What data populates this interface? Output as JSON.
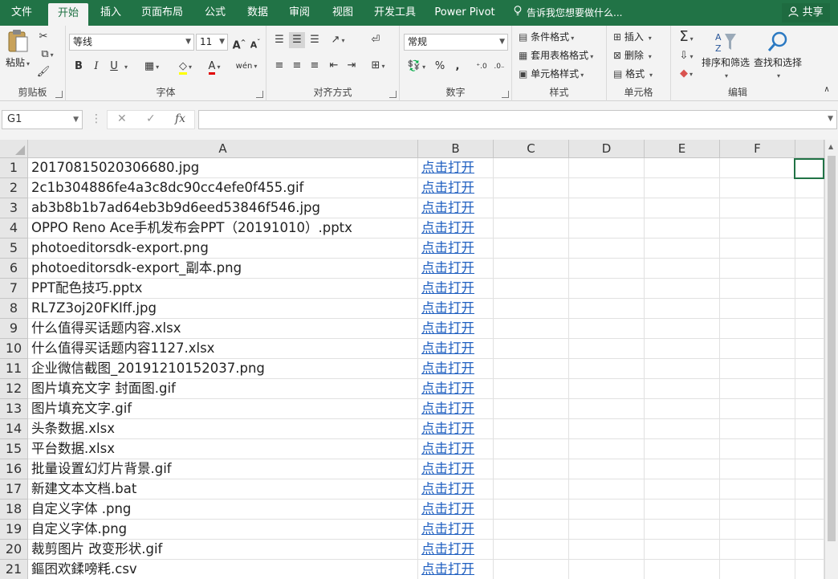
{
  "tabs": [
    {
      "label": "文件",
      "active": false
    },
    {
      "label": "开始",
      "active": true
    },
    {
      "label": "插入",
      "active": false
    },
    {
      "label": "页面布局",
      "active": false
    },
    {
      "label": "公式",
      "active": false
    },
    {
      "label": "数据",
      "active": false
    },
    {
      "label": "审阅",
      "active": false
    },
    {
      "label": "视图",
      "active": false
    },
    {
      "label": "开发工具",
      "active": false
    },
    {
      "label": "Power Pivot",
      "active": false
    }
  ],
  "tell_me": "告诉我您想要做什么...",
  "share": "共享",
  "ribbon": {
    "clipboard": {
      "paste": "粘贴",
      "label": "剪贴板"
    },
    "font": {
      "name": "等线",
      "size": "11",
      "label": "字体",
      "bold": "B",
      "italic": "I",
      "underline": "U",
      "grow": "A",
      "shrink": "A",
      "wen": "wén"
    },
    "alignment": {
      "label": "对齐方式"
    },
    "number": {
      "format": "常规",
      "label": "数字",
      "percent": "%"
    },
    "styles": {
      "conditional": "条件格式",
      "table": "套用表格格式",
      "cell": "单元格样式",
      "label": "样式"
    },
    "cells": {
      "insert": "插入",
      "delete": "删除",
      "format": "格式",
      "label": "单元格"
    },
    "editing": {
      "sort": "排序和筛选",
      "find": "查找和选择",
      "label": "编辑"
    }
  },
  "name_box": "G1",
  "formula": "",
  "columns": [
    "A",
    "B",
    "C",
    "D",
    "E",
    "F"
  ],
  "rows": [
    {
      "num": "1",
      "a": "20170815020306680.jpg",
      "b": "点击打开"
    },
    {
      "num": "2",
      "a": "2c1b304886fe4a3c8dc90cc4efe0f455.gif",
      "b": "点击打开"
    },
    {
      "num": "3",
      "a": "ab3b8b1b7ad64eb3b9d6eed53846f546.jpg",
      "b": "点击打开"
    },
    {
      "num": "4",
      "a": "OPPO Reno Ace手机发布会PPT（20191010）.pptx",
      "b": "点击打开"
    },
    {
      "num": "5",
      "a": "photoeditorsdk-export.png",
      "b": "点击打开"
    },
    {
      "num": "6",
      "a": "photoeditorsdk-export_副本.png",
      "b": "点击打开"
    },
    {
      "num": "7",
      "a": "PPT配色技巧.pptx",
      "b": "点击打开"
    },
    {
      "num": "8",
      "a": "RL7Z3oj20FKIff.jpg",
      "b": "点击打开"
    },
    {
      "num": "9",
      "a": "什么值得买话题内容.xlsx",
      "b": "点击打开"
    },
    {
      "num": "10",
      "a": "什么值得买话题内容1127.xlsx",
      "b": "点击打开"
    },
    {
      "num": "11",
      "a": "企业微信截图_20191210152037.png",
      "b": "点击打开"
    },
    {
      "num": "12",
      "a": "图片填充文字 封面图.gif",
      "b": "点击打开"
    },
    {
      "num": "13",
      "a": "图片填充文字.gif",
      "b": "点击打开"
    },
    {
      "num": "14",
      "a": "头条数据.xlsx",
      "b": "点击打开"
    },
    {
      "num": "15",
      "a": "平台数据.xlsx",
      "b": "点击打开"
    },
    {
      "num": "16",
      "a": "批量设置幻灯片背景.gif",
      "b": "点击打开"
    },
    {
      "num": "17",
      "a": "新建文本文档.bat",
      "b": "点击打开"
    },
    {
      "num": "18",
      "a": "自定义字体 .png",
      "b": "点击打开"
    },
    {
      "num": "19",
      "a": "自定义字体.png",
      "b": "点击打开"
    },
    {
      "num": "20",
      "a": "裁剪图片 改变形状.gif",
      "b": "点击打开"
    },
    {
      "num": "21",
      "a": "鏂囨欢鍒嗙粍.csv",
      "b": "点击打开"
    }
  ],
  "colors": {
    "accent": "#217346",
    "link": "#1f5fc0",
    "header_bg": "#e6e6e6"
  }
}
